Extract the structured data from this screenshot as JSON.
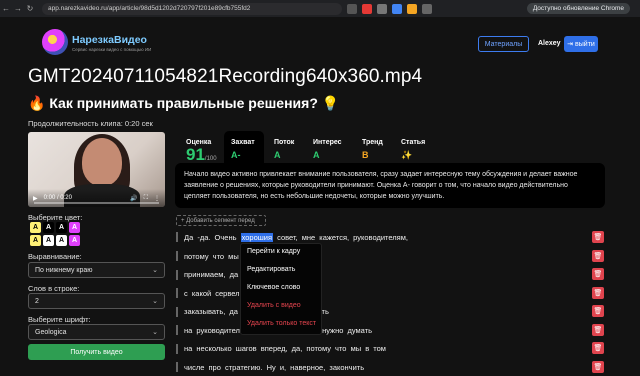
{
  "browser": {
    "url": "app.narezkavideo.ru/app/article/98d5d1202d720797f201e89cfb755fd2",
    "update_label": "Доступно обновление Chrome"
  },
  "header": {
    "logo_title": "НарезкаВидео",
    "logo_subtitle": "Сервис нарезки видео с помощью ИИ",
    "materials_label": "Материалы",
    "user_name": "Alexey",
    "logout_label": "выйти"
  },
  "page": {
    "file_title": "GMT20240711054821Recording640x360.mp4",
    "clip_title": "🔥 Как принимать правильные решения? 💡",
    "duration": "Продолжительность клипа: 0:20 сек"
  },
  "video": {
    "time": "0:00 / 0:20",
    "progress": 0
  },
  "left_panel": {
    "color_label": "Выберите цвет:",
    "swatches": [
      {
        "letter": "A",
        "bg": "#fff176",
        "fg": "#000"
      },
      {
        "letter": "A",
        "bg": "#000000",
        "fg": "#fff"
      },
      {
        "letter": "A",
        "bg": "#000000",
        "fg": "#fff"
      },
      {
        "letter": "A",
        "bg": "#e040fb",
        "fg": "#fff"
      },
      {
        "letter": "A",
        "bg": "#fff176",
        "fg": "#000"
      },
      {
        "letter": "A",
        "bg": "#ffffff",
        "fg": "#000"
      },
      {
        "letter": "A",
        "bg": "#ffffff",
        "fg": "#000"
      },
      {
        "letter": "A",
        "bg": "#e040fb",
        "fg": "#fff"
      }
    ],
    "align_label": "Выравнивание:",
    "align_value": "По нижнему краю",
    "words_label": "Слов в строке:",
    "words_value": "2",
    "font_label": "Выберите шрифт:",
    "font_value": "Geologica",
    "get_video_label": "Получить видео"
  },
  "metrics": [
    {
      "title": "Оценка",
      "value": "91",
      "suffix": "/100",
      "color": "#2ecc71"
    },
    {
      "title": "Захват",
      "value": "A-",
      "color": "#2ecc71"
    },
    {
      "title": "Поток",
      "value": "A",
      "color": "#2ecc71"
    },
    {
      "title": "Интерес",
      "value": "A",
      "color": "#2ecc71"
    },
    {
      "title": "Тренд",
      "value": "B",
      "color": "#f5a623"
    },
    {
      "title": "Статья",
      "value": "✨",
      "color": "#ffd54f"
    }
  ],
  "description": "Начало видео активно привлекает внимание пользователя, сразу задает интересную тему обсуждения и делает важное заявление о решениях, которые руководители принимают. Оценка А- говорит о том, что начало видео действительно цепляет пользователя, но есть небольшие недочеты, которые можно улучшить.",
  "add_segment_label": "+ Добавить сегмент перед",
  "transcript": {
    "highlighted_word": "хорошия",
    "row0_before": "Да  -да.  Очень ",
    "row0_after": " совет,  мне  кажется,  руководителям,",
    "rows": [
      "потому  что  мы                                        ого  решений",
      "принимаем,  да                                        неров,  подрядчиков,",
      "с  какой  сервел                                       от,  какие  учебники",
      "заказывать,  да                                        ,  такая  ответственность",
      "на  руководителе.  И  лучше,  конечно,  нужно  думать",
      "на  несколько  шагов  вперед,  да,  потому  что  мы  в  том",
      "числе  про  стратегию.  Ну  и,  наверное,  закончить"
    ]
  },
  "context_menu": {
    "items": [
      {
        "label": "Перейти к кадру",
        "danger": false
      },
      {
        "label": "Редактировать",
        "danger": false
      },
      {
        "label": "Ключевое слово",
        "danger": false
      },
      {
        "label": "Удалить с видео",
        "danger": true
      },
      {
        "label": "Удалить только текст",
        "danger": true
      }
    ]
  }
}
